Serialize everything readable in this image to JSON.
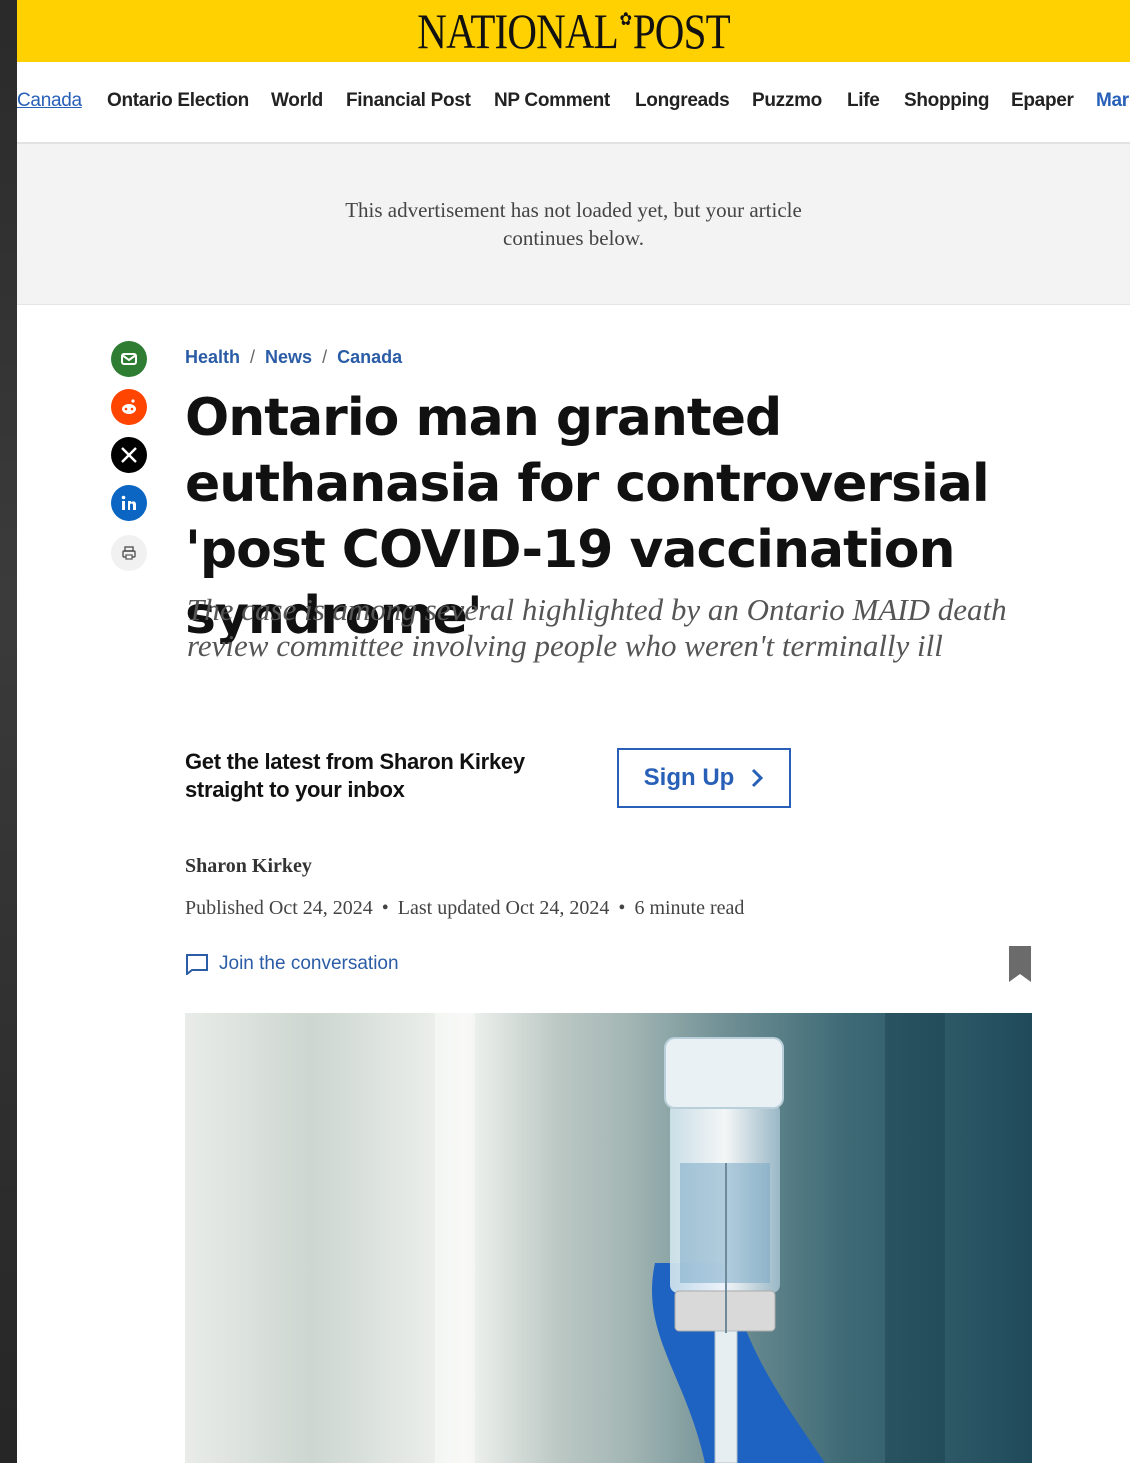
{
  "masthead": {
    "logo_left": "NATIONAL",
    "logo_right": "POST"
  },
  "nav": {
    "items": [
      "Canada",
      "Ontario Election",
      "World",
      "Financial Post",
      "NP Comment",
      "Longreads",
      "Puzzmo",
      "Life",
      "Shopping",
      "Epaper"
    ],
    "more_label": "Mar"
  },
  "ad": {
    "text": "This advertisement has not loaded yet, but your article continues below."
  },
  "share": {
    "icons": [
      "email-icon",
      "reddit-icon",
      "x-icon",
      "linkedin-icon",
      "print-icon"
    ]
  },
  "breadcrumb": {
    "items": [
      "Health",
      "News",
      "Canada"
    ],
    "separator": "/"
  },
  "article": {
    "headline": "Ontario man granted euthanasia for controversial 'post COVID-19 vaccination syndrome'",
    "subheadline": "The case is among several highlighted by an Ontario MAID death review committee involving people who weren't terminally ill",
    "newsletter_promo": "Get the latest from Sharon Kirkey straight to your inbox",
    "signup_label": "Sign Up",
    "author": "Sharon Kirkey",
    "published": "Published Oct 24, 2024",
    "updated": "Last updated Oct 24, 2024",
    "read_time": "6 minute read",
    "conversation_label": "Join the conversation"
  },
  "colors": {
    "brand_yellow": "#ffd100",
    "link_blue": "#2860b8",
    "email_green": "#2e7d32",
    "reddit_orange": "#ff4500",
    "linkedin_blue": "#0a66c2"
  }
}
